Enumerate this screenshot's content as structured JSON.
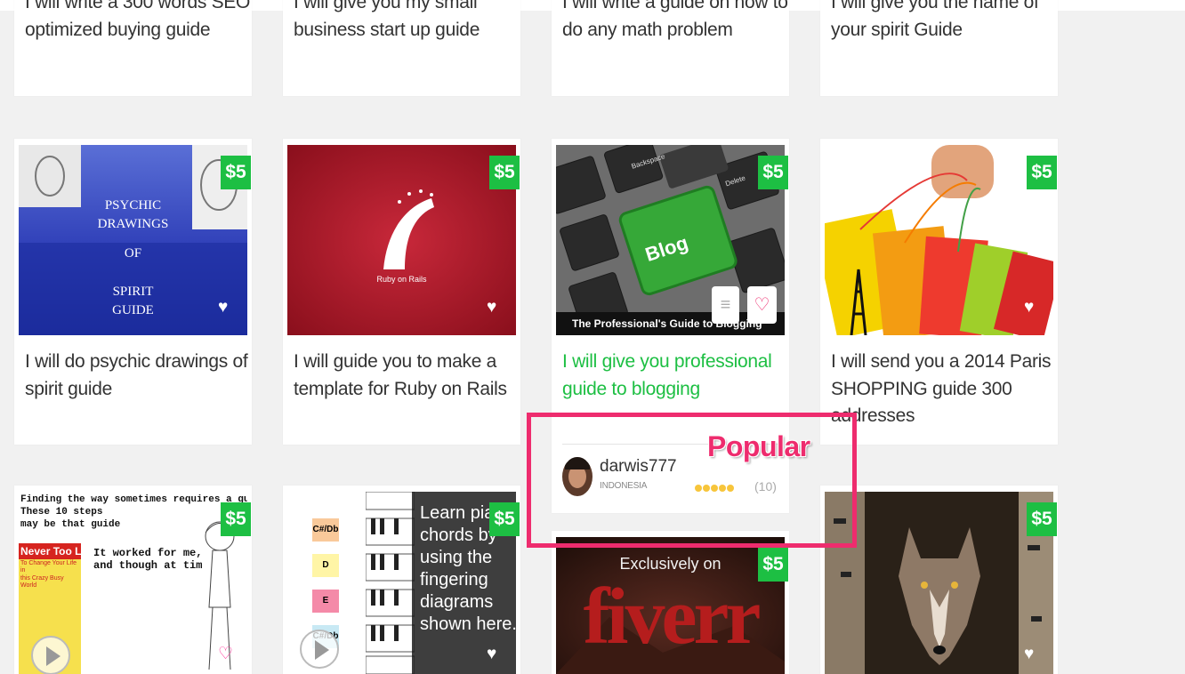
{
  "colors": {
    "accent_green": "#1dbf43",
    "highlight_pink": "#ee2c6e",
    "page_bg": "#f1f1f1",
    "star_gold": "#f7c53b"
  },
  "top_row": [
    {
      "title_line1": "I will write a 300 words SEO",
      "title_line2": "optimized buying guide"
    },
    {
      "title_line1": "I will give you my small",
      "title_line2": "business start up guide"
    },
    {
      "title_line1": "I will write a guide on how to",
      "title_line2": "do any math problem"
    },
    {
      "title_line1": "I will give you the name of",
      "title_line2": "your spirit Guide"
    }
  ],
  "gigs": [
    {
      "title_line1": "I will do psychic drawings of",
      "title_line2": "spirit guide",
      "price": "$5",
      "thumb_text": [
        "PSYCHIC",
        "DRAWINGS",
        "OF",
        "SPIRIT",
        "GUIDE"
      ]
    },
    {
      "title_line1": "I will guide you to make a",
      "title_line2": "template for Ruby on Rails",
      "price": "$5",
      "thumb_text": [
        "Ruby on Rails"
      ]
    },
    {
      "title_line1": "I will give you professional",
      "title_line2": "guide to blogging",
      "price": "$5",
      "thumb_text": [
        "Blog",
        "The Professional's Guide to Blogging",
        "Backspace",
        "Delete"
      ]
    },
    {
      "title_line1": "I will send you a 2014 Paris",
      "title_line2": "SHOPPING guide 300",
      "title_line3": "addresses",
      "price": "$5"
    }
  ],
  "seller": {
    "name": "darwis777",
    "country": "INDONESIA",
    "rating_count": "(10)",
    "rating_stars": 5
  },
  "annotation": {
    "label": "Popular"
  },
  "bottom_row": [
    {
      "price": "$5",
      "thumb_text": [
        "Finding the way sometimes requires a guide.",
        "These 10 steps",
        "may be that guide",
        "It worked for me,",
        "and though at tim",
        "Never Too Late",
        "To Change Your Life in",
        "this Crazy Busy World"
      ]
    },
    {
      "price": "$5",
      "overlay_lines": [
        "Learn piano",
        "chords by",
        "using the",
        "fingering",
        "diagrams",
        "shown here..."
      ],
      "chord_labels": [
        "C#/Db",
        "D",
        "E",
        "C#/Db"
      ]
    },
    {
      "price": "$5",
      "thumb_text": [
        "Exclusively on",
        "fiverr"
      ]
    },
    {
      "price": "$5"
    }
  ]
}
